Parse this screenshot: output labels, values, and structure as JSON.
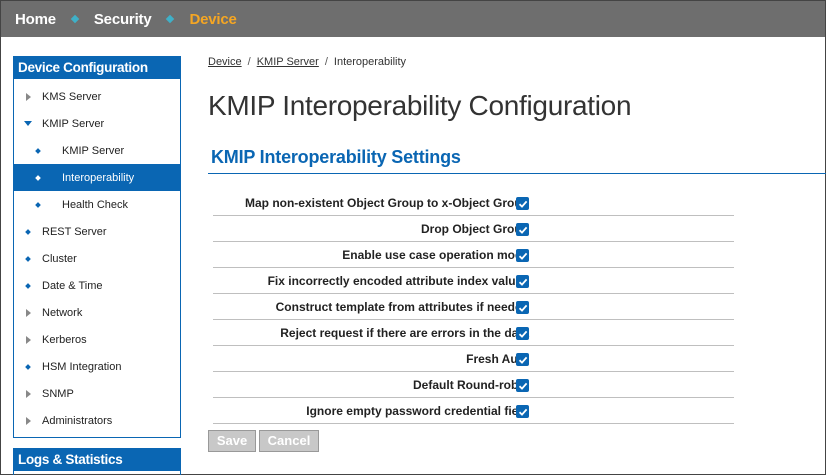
{
  "topnav": {
    "items": [
      {
        "label": "Home"
      },
      {
        "label": "Security"
      },
      {
        "label": "Device"
      }
    ]
  },
  "sidebar": {
    "header": "Device Configuration",
    "items": [
      {
        "label": "KMS Server"
      },
      {
        "label": "KMIP Server"
      },
      {
        "label": "KMIP Server"
      },
      {
        "label": "Interoperability"
      },
      {
        "label": "Health Check"
      },
      {
        "label": "REST Server"
      },
      {
        "label": "Cluster"
      },
      {
        "label": "Date & Time"
      },
      {
        "label": "Network"
      },
      {
        "label": "Kerberos"
      },
      {
        "label": "HSM Integration"
      },
      {
        "label": "SNMP"
      },
      {
        "label": "Administrators"
      }
    ],
    "header2": "Logs & Statistics"
  },
  "breadcrumb": {
    "items": [
      "Device",
      "KMIP Server",
      "Interoperability"
    ],
    "separator": "/"
  },
  "page_title": "KMIP Interoperability Configuration",
  "section_title": "KMIP Interoperability Settings",
  "settings": [
    {
      "label": "Map non-existent Object Group to x-Object Group",
      "checked": true
    },
    {
      "label": "Drop Object Group",
      "checked": true
    },
    {
      "label": "Enable use case operation mode",
      "checked": true
    },
    {
      "label": "Fix incorrectly encoded attribute index values",
      "checked": true
    },
    {
      "label": "Construct template from attributes if needed",
      "checked": true
    },
    {
      "label": "Reject request if there are errors in the data",
      "checked": true
    },
    {
      "label": "Fresh Auto",
      "checked": true
    },
    {
      "label": "Default Round-robin",
      "checked": true
    },
    {
      "label": "Ignore empty password credential field",
      "checked": true
    }
  ],
  "buttons": {
    "save": "Save",
    "cancel": "Cancel"
  },
  "colors": {
    "accent": "#0a66b3",
    "nav_bg": "#6e6e6e",
    "nav_active": "#f5a623"
  }
}
